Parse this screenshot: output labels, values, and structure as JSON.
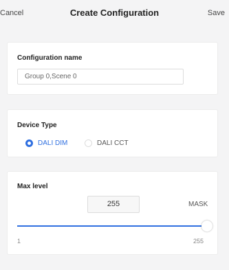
{
  "header": {
    "cancel_label": "Cancel",
    "title": "Create Configuration",
    "save_label": "Save"
  },
  "configuration_name": {
    "label": "Configuration name",
    "value": "Group 0,Scene 0"
  },
  "device_type": {
    "label": "Device Type",
    "options": [
      {
        "label": "DALI DIM",
        "selected": true
      },
      {
        "label": "DALI CCT",
        "selected": false
      }
    ]
  },
  "max_level": {
    "label": "Max level",
    "value": "255",
    "mask_label": "MASK",
    "slider": {
      "min": "1",
      "max": "255",
      "current": 255
    }
  },
  "colors": {
    "accent": "#2f6fe0",
    "background": "#f4f4f5",
    "card": "#ffffff"
  }
}
